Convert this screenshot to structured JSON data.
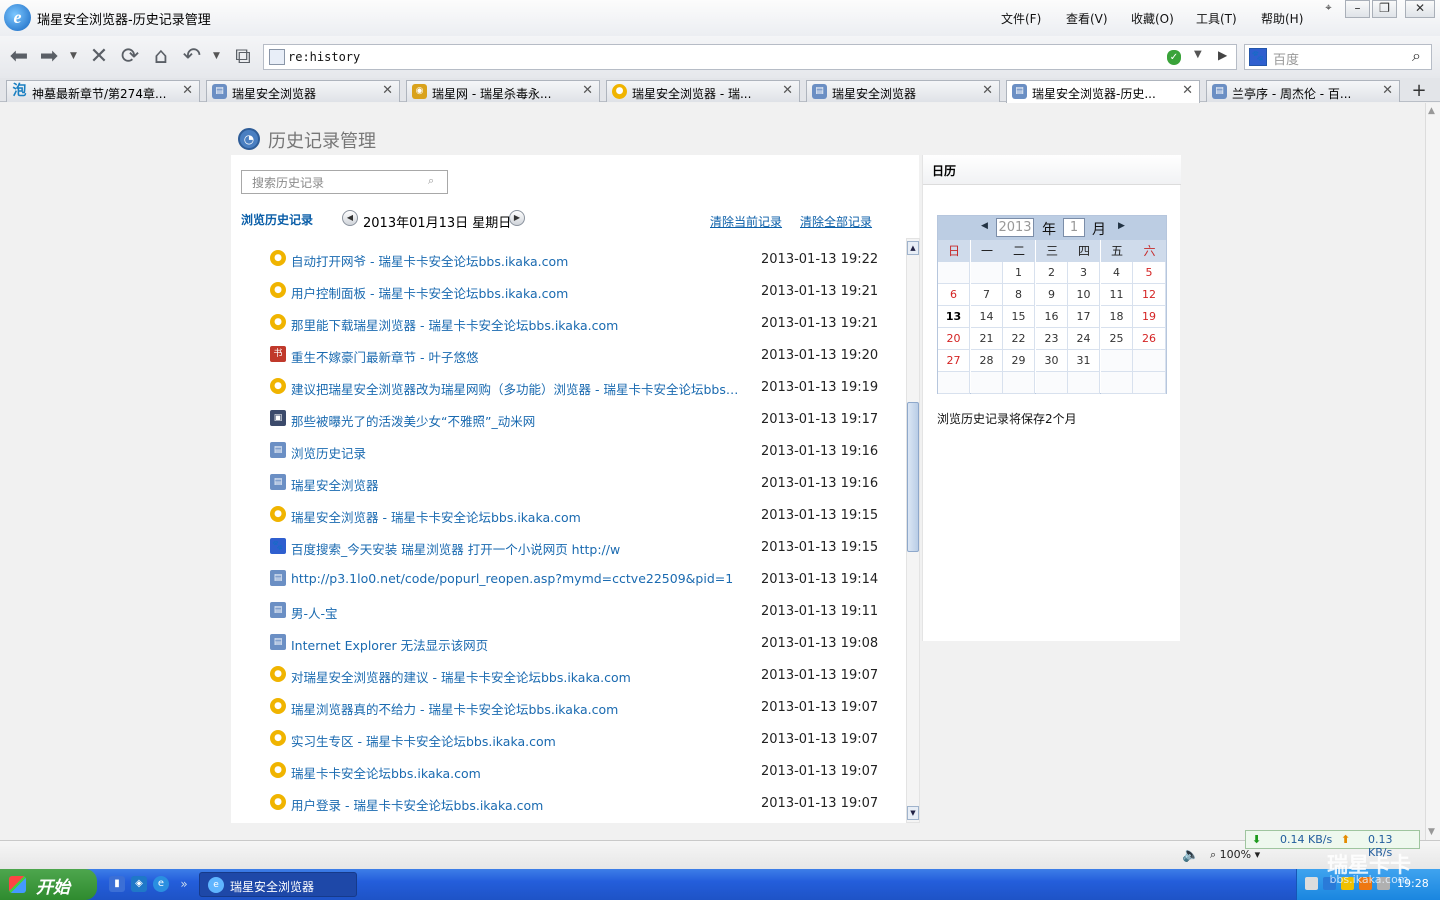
{
  "window": {
    "title": "瑞星安全浏览器-历史记录管理",
    "menus": [
      "文件(F)",
      "查看(V)",
      "收藏(O)",
      "工具(T)",
      "帮助(H)"
    ]
  },
  "nav": {
    "url": "re:history",
    "search_placeholder": "百度"
  },
  "tabs": [
    {
      "label": "神墓最新章节/第274章...",
      "icon": "pao-icon",
      "color": "#e8f4ff",
      "active": false
    },
    {
      "label": "瑞星安全浏览器",
      "icon": "page-icon",
      "color": "#6b8fc4",
      "active": false
    },
    {
      "label": "瑞星网 - 瑞星杀毒永...",
      "icon": "lion-icon",
      "color": "#d9a21c",
      "active": false
    },
    {
      "label": "瑞星安全浏览器 - 瑞...",
      "icon": "forum-icon",
      "color": "#f0b400",
      "active": false
    },
    {
      "label": "瑞星安全浏览器",
      "icon": "page-icon",
      "color": "#6b8fc4",
      "active": false
    },
    {
      "label": "瑞星安全浏览器-历史...",
      "icon": "page-icon",
      "color": "#6b8fc4",
      "active": true
    },
    {
      "label": "兰亭序 - 周杰伦 - 百...",
      "icon": "page-icon",
      "color": "#6b8fc4",
      "active": false
    }
  ],
  "page": {
    "title": "历史记录管理",
    "search_placeholder": "搜索历史记录",
    "browse_label": "浏览历史记录",
    "date": "2013年01月13日  星期日",
    "clear_current": "清除当前记录",
    "clear_all": "清除全部记录"
  },
  "history": [
    {
      "title": "自动打开网爷 - 瑞星卡卡安全论坛bbs.ikaka.com",
      "time": "2013-01-13 19:22",
      "icon": "forum",
      "color": "#f0b400"
    },
    {
      "title": "用户控制面板 - 瑞星卡卡安全论坛bbs.ikaka.com",
      "time": "2013-01-13 19:21",
      "icon": "forum",
      "color": "#f0b400"
    },
    {
      "title": "那里能下载瑞星浏览器 - 瑞星卡卡安全论坛bbs.ikaka.com",
      "time": "2013-01-13 19:21",
      "icon": "forum",
      "color": "#f0b400"
    },
    {
      "title": "重生不嫁豪门最新章节 - 叶子悠悠",
      "time": "2013-01-13 19:20",
      "icon": "novel",
      "color": "#c0392b"
    },
    {
      "title": "建议把瑞星安全浏览器改为瑞星网购（多功能）浏览器 - 瑞星卡卡安全论坛bbs.ikaka.com",
      "time": "2013-01-13 19:19",
      "icon": "forum",
      "color": "#f0b400"
    },
    {
      "title": "那些被曝光了的活泼美少女“不雅照”_动米网",
      "time": "2013-01-13 19:17",
      "icon": "image",
      "color": "#3b4a6b"
    },
    {
      "title": "浏览历史记录",
      "time": "2013-01-13 19:16",
      "icon": "page",
      "color": "#6b8fc4"
    },
    {
      "title": "瑞星安全浏览器",
      "time": "2013-01-13 19:16",
      "icon": "page",
      "color": "#6b8fc4"
    },
    {
      "title": "瑞星安全浏览器 - 瑞星卡卡安全论坛bbs.ikaka.com",
      "time": "2013-01-13 19:15",
      "icon": "forum",
      "color": "#f0b400"
    },
    {
      "title": "百度搜索_今天安装 瑞星浏览器 打开一个小说网页 http://w",
      "time": "2013-01-13 19:15",
      "icon": "baidu",
      "color": "#2f5fcf"
    },
    {
      "title": "http://p3.1lo0.net/code/popurl_reopen.asp?mymd=cctve22509&pid=1",
      "time": "2013-01-13 19:14",
      "icon": "page",
      "color": "#6b8fc4"
    },
    {
      "title": "男-人-宝",
      "time": "2013-01-13 19:11",
      "icon": "page",
      "color": "#6b8fc4"
    },
    {
      "title": "Internet Explorer 无法显示该网页",
      "time": "2013-01-13 19:08",
      "icon": "page",
      "color": "#6b8fc4"
    },
    {
      "title": "对瑞星安全浏览器的建议 - 瑞星卡卡安全论坛bbs.ikaka.com",
      "time": "2013-01-13 19:07",
      "icon": "forum",
      "color": "#f0b400"
    },
    {
      "title": "瑞星浏览器真的不给力 - 瑞星卡卡安全论坛bbs.ikaka.com",
      "time": "2013-01-13 19:07",
      "icon": "forum",
      "color": "#f0b400"
    },
    {
      "title": "实习生专区 - 瑞星卡卡安全论坛bbs.ikaka.com",
      "time": "2013-01-13 19:07",
      "icon": "forum",
      "color": "#f0b400"
    },
    {
      "title": "瑞星卡卡安全论坛bbs.ikaka.com",
      "time": "2013-01-13 19:07",
      "icon": "forum",
      "color": "#f0b400"
    },
    {
      "title": "用户登录 - 瑞星卡卡安全论坛bbs.ikaka.com",
      "time": "2013-01-13 19:07",
      "icon": "forum",
      "color": "#f0b400"
    }
  ],
  "calendar": {
    "title": "日历",
    "year": "2013",
    "year_suffix": "年",
    "month": "1",
    "month_suffix": "月",
    "weekdays": [
      "日",
      "一",
      "二",
      "三",
      "四",
      "五",
      "六"
    ],
    "days": [
      [
        "",
        "",
        "1",
        "2",
        "3",
        "4",
        "5"
      ],
      [
        "6",
        "7",
        "8",
        "9",
        "10",
        "11",
        "12"
      ],
      [
        "13",
        "14",
        "15",
        "16",
        "17",
        "18",
        "19"
      ],
      [
        "20",
        "21",
        "22",
        "23",
        "24",
        "25",
        "26"
      ],
      [
        "27",
        "28",
        "29",
        "30",
        "31",
        "",
        ""
      ],
      [
        "",
        "",
        "",
        "",
        "",
        "",
        ""
      ]
    ],
    "today": "13",
    "keep_note": "浏览历史记录将保存2个月"
  },
  "status": {
    "zoom": "100%",
    "down_speed": "0.14 KB/s",
    "up_speed": "0.13 KB/s"
  },
  "taskbar": {
    "start": "开始",
    "task_label": "瑞星安全浏览器",
    "time": "19:28",
    "watermark": "瑞星卡卡",
    "watermark_url": "bbs.ikaka.com"
  }
}
